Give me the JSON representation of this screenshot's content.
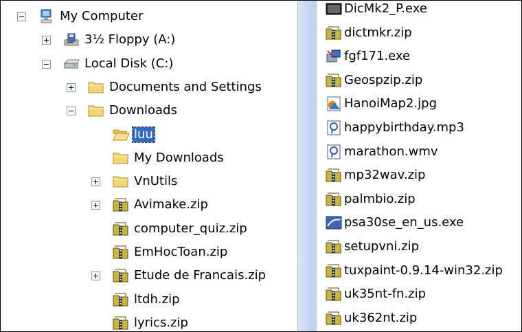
{
  "tree": {
    "nodes": [
      {
        "label": "My Computer",
        "icon": "my-computer-icon",
        "expander": "minus"
      },
      {
        "label": "3½ Floppy (A:)",
        "icon": "floppy-drive-icon",
        "expander": "plus"
      },
      {
        "label": "Local Disk (C:)",
        "icon": "hard-disk-icon",
        "expander": "minus"
      },
      {
        "label": "Documents and Settings",
        "icon": "folder-icon",
        "expander": "plus"
      },
      {
        "label": "Downloads",
        "icon": "folder-icon",
        "expander": "minus"
      },
      {
        "label": "luu",
        "icon": "open-folder-icon",
        "expander": "none",
        "selected": true
      },
      {
        "label": "My Downloads",
        "icon": "folder-icon",
        "expander": "none"
      },
      {
        "label": "VnUtils",
        "icon": "folder-icon",
        "expander": "plus"
      },
      {
        "label": "Avimake.zip",
        "icon": "zip-folder-icon",
        "expander": "plus"
      },
      {
        "label": "computer_quiz.zip",
        "icon": "zip-folder-icon",
        "expander": "none"
      },
      {
        "label": "EmHocToan.zip",
        "icon": "zip-folder-icon",
        "expander": "none"
      },
      {
        "label": "Etude de Francais.zip",
        "icon": "zip-folder-icon",
        "expander": "plus"
      },
      {
        "label": "ltdh.zip",
        "icon": "zip-folder-icon",
        "expander": "none"
      },
      {
        "label": "lyrics.zip",
        "icon": "zip-folder-icon",
        "expander": "none"
      }
    ]
  },
  "files": {
    "items": [
      {
        "label": "DicMk2_P.exe",
        "icon": "exe-icon"
      },
      {
        "label": "dictmkr.zip",
        "icon": "zip-folder-icon"
      },
      {
        "label": "fgf171.exe",
        "icon": "installer-icon"
      },
      {
        "label": "Geospzip.zip",
        "icon": "zip-folder-icon"
      },
      {
        "label": "HanoiMap2.jpg",
        "icon": "image-file-icon"
      },
      {
        "label": "happybirthday.mp3",
        "icon": "media-file-icon"
      },
      {
        "label": "marathon.wmv",
        "icon": "media-file-icon"
      },
      {
        "label": "mp32wav.zip",
        "icon": "zip-folder-icon"
      },
      {
        "label": "palmbio.zip",
        "icon": "zip-folder-icon"
      },
      {
        "label": "psa30se_en_us.exe",
        "icon": "app-exe-icon"
      },
      {
        "label": "setupvni.zip",
        "icon": "zip-folder-icon"
      },
      {
        "label": "tuxpaint-0.9.14-win32.zip",
        "icon": "zip-folder-icon"
      },
      {
        "label": "uk35nt-fn.zip",
        "icon": "zip-folder-icon"
      },
      {
        "label": "uk362nt.zip",
        "icon": "zip-folder-icon"
      }
    ]
  },
  "colors": {
    "selection": "#316ac5",
    "folder": "#f5d678",
    "zip": "#c9b640",
    "splitter": "#c6d7f2"
  }
}
